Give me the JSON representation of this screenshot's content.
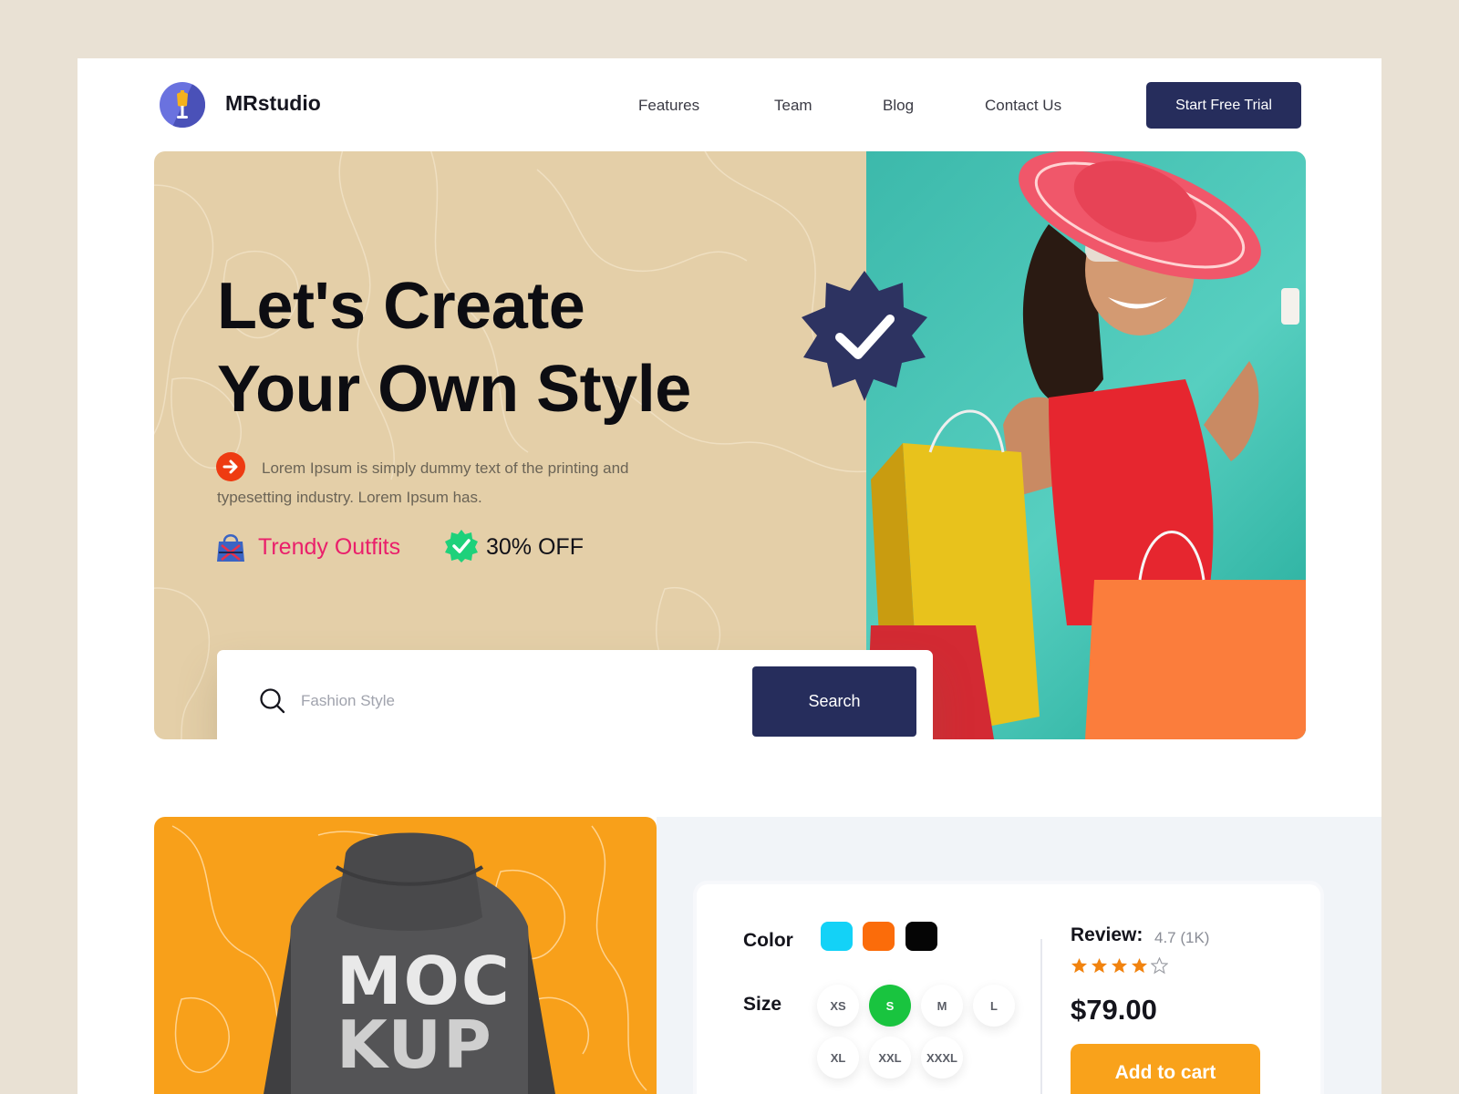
{
  "nav": {
    "brand": "MRstudio",
    "items": [
      "Features",
      "Team",
      "Blog",
      "Contact Us"
    ],
    "cta": "Start Free Trial"
  },
  "hero": {
    "title_line1": "Let's Create",
    "title_line2": "Your Own Style",
    "description": "Lorem Ipsum is simply dummy text of the printing and typesetting industry. Lorem Ipsum has.",
    "tag_trendy": "Trendy Outfits",
    "tag_off": "30% OFF",
    "search_placeholder": "Fashion Style",
    "search_button": "Search"
  },
  "product": {
    "mockup_line1": "MOC",
    "mockup_line2": "KUP",
    "color_label": "Color",
    "colors": [
      "#13d2f7",
      "#fb6c0a",
      "#050505"
    ],
    "size_label": "Size",
    "sizes": [
      "XS",
      "S",
      "M",
      "L",
      "XL",
      "XXL",
      "XXXL"
    ],
    "selected_size": "S",
    "review_label": "Review:",
    "review_value": "4.7 (1K)",
    "rating": 4,
    "rating_max": 5,
    "price": "$79.00",
    "cart_button": "Add to cart"
  },
  "colors": {
    "navy": "#262d5c",
    "accent_orange": "#f9a21b",
    "pink": "#ea1f6b",
    "green": "#19c43f"
  }
}
